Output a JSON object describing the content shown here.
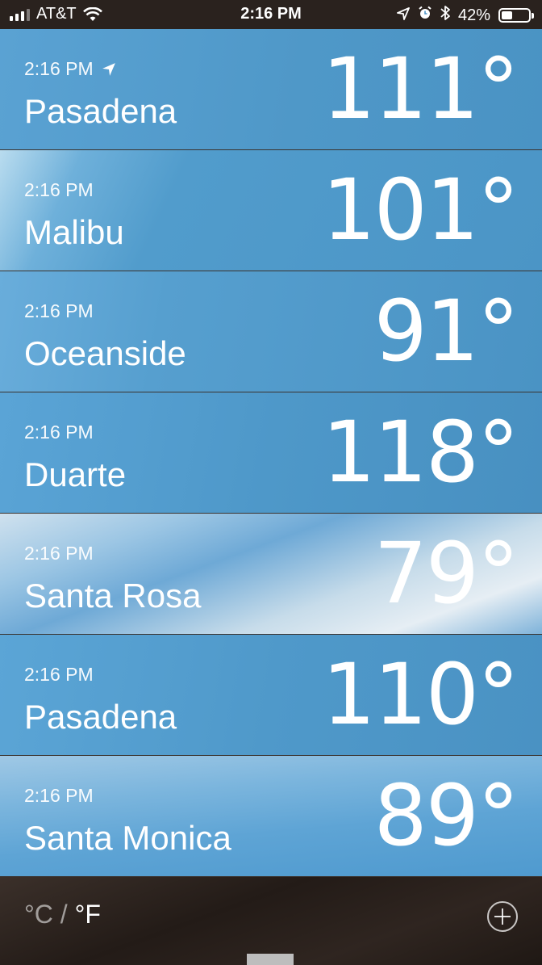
{
  "status_bar": {
    "carrier": "AT&T",
    "time": "2:16 PM",
    "battery_percent": "42%",
    "battery_level": 0.42,
    "icons": [
      "signal-icon",
      "wifi-icon",
      "location-icon",
      "alarm-icon",
      "bluetooth-icon",
      "battery-icon"
    ]
  },
  "cities": [
    {
      "time": "2:16 PM",
      "name": "Pasadena",
      "temp": "111°",
      "current_location": true,
      "bg": "linear-gradient(100deg, #5aa2d3 0%, #4f98c8 55%, #4a93c4 100%)"
    },
    {
      "time": "2:16 PM",
      "name": "Malibu",
      "temp": "101°",
      "current_location": false,
      "bg": "linear-gradient(115deg, #b9dcef 0%, #6eb0da 14%, #519ccc 32%, #4b95c6 100%)"
    },
    {
      "time": "2:16 PM",
      "name": "Oceanside",
      "temp": "91°",
      "current_location": false,
      "bg": "linear-gradient(100deg, #69addb 0%, #569fcf 30%, #4a93c4 100%)"
    },
    {
      "time": "2:16 PM",
      "name": "Duarte",
      "temp": "118°",
      "current_location": false,
      "bg": "linear-gradient(100deg, #5aa4d6 0%, #4e98c9 50%, #4890c1 100%)"
    },
    {
      "time": "2:16 PM",
      "name": "Santa Rosa",
      "temp": "79°",
      "current_location": false,
      "bg": "linear-gradient(160deg, #cfe1ee 0%, #9cc6e4 22%, #6ea9d6 40%, #c7dcea 65%, #e6eef4 82%, #7fb3da 100%)"
    },
    {
      "time": "2:16 PM",
      "name": "Pasadena",
      "temp": "110°",
      "current_location": false,
      "bg": "linear-gradient(100deg, #5ba5d6 0%, #4f99ca 50%, #4a92c3 100%)"
    },
    {
      "time": "2:16 PM",
      "name": "Santa Monica",
      "temp": "89°",
      "current_location": false,
      "bg": "linear-gradient(175deg, #9fc8e5 0%, #7bb5dd 30%, #5ea4d5 60%, #4f9acf 100%)"
    }
  ],
  "toolbar": {
    "celsius": "°C",
    "separator": " / ",
    "fahrenheit": "°F",
    "add_icon": "plus-circle-icon"
  }
}
